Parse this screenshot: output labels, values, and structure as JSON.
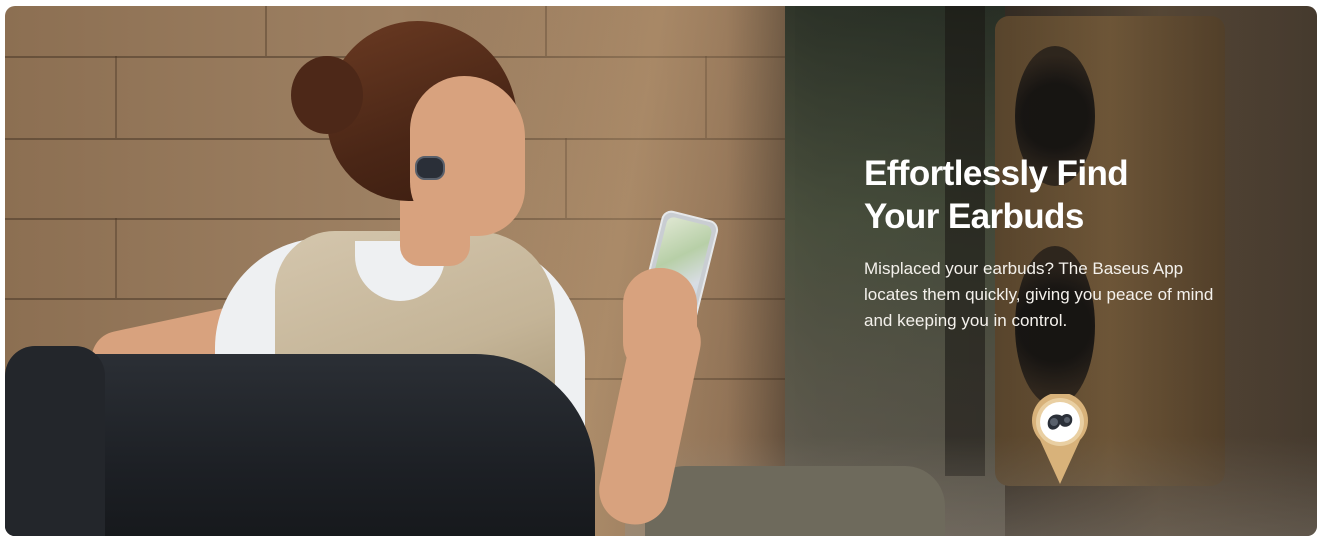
{
  "hero": {
    "headline": "Effortlessly Find Your Earbuds",
    "description": "Misplaced your earbuds? The Baseus App locates them quickly, giving you peace of mind and keeping you in control."
  },
  "icons": {
    "location_pin": "earbud-location-pin-icon",
    "map_on_phone": "map-icon"
  },
  "colors": {
    "headline": "#ffffff",
    "body_text": "#f4f1ec",
    "pin_gold": "#d8b27a",
    "earbud": "#2a2f38"
  }
}
